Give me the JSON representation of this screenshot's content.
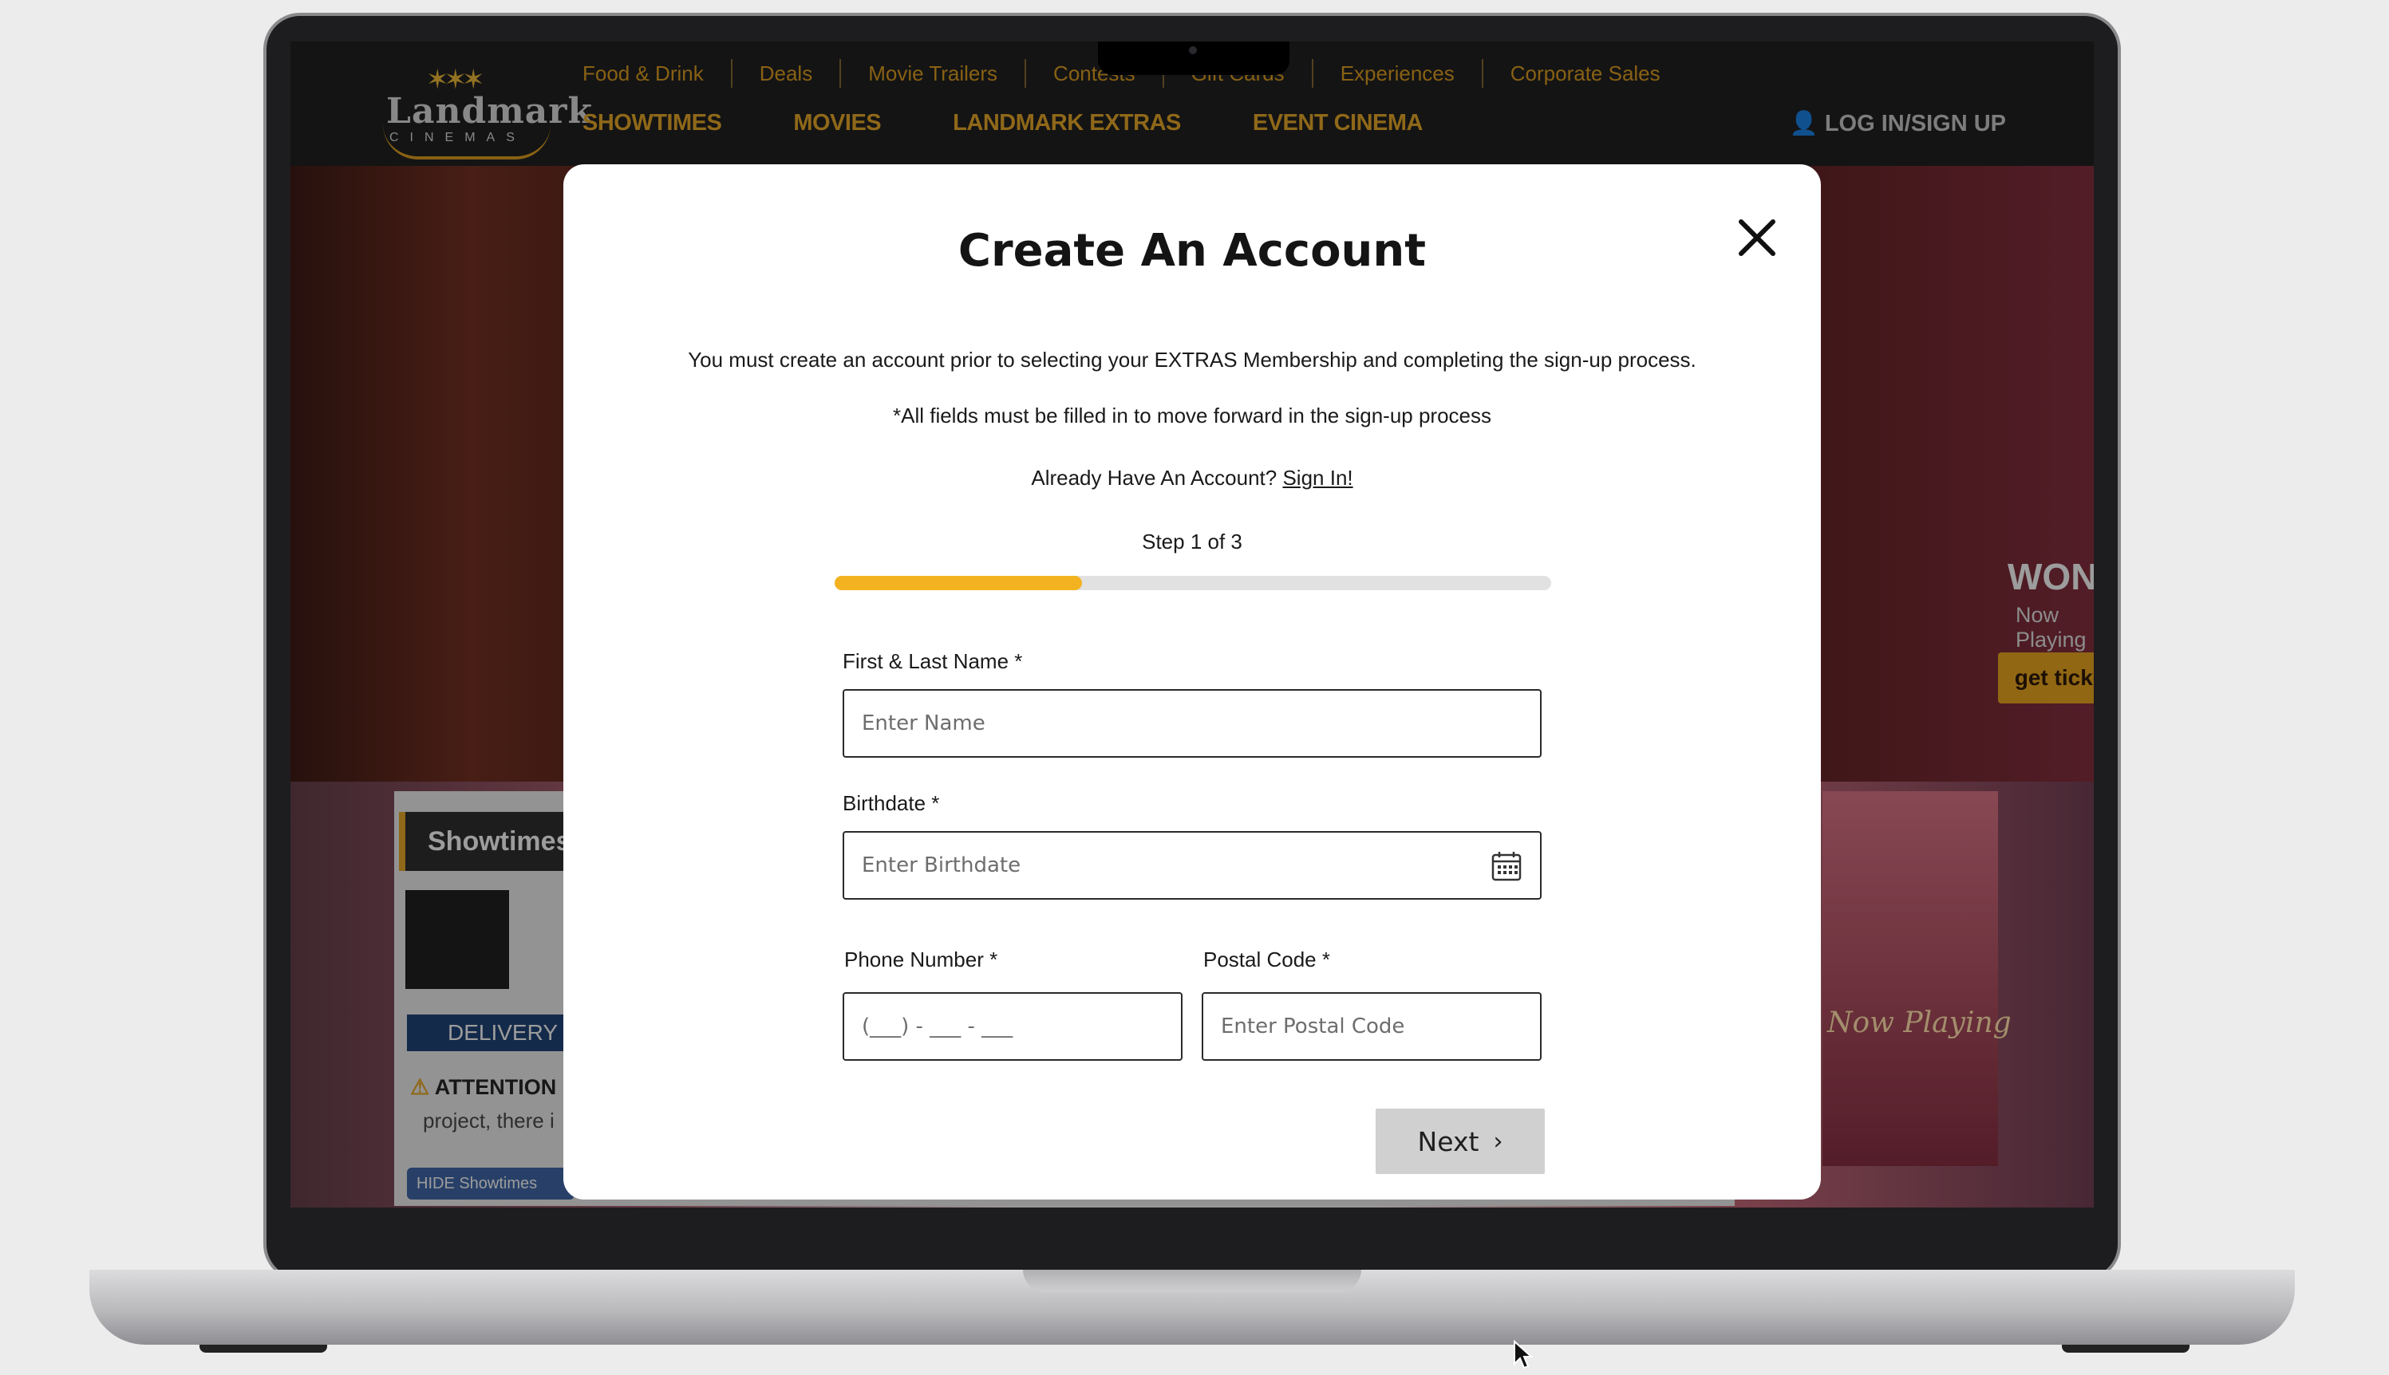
{
  "site": {
    "logo": {
      "word": "Landmark",
      "sub": "CINEMAS"
    },
    "top_links": [
      "Food & Drink",
      "Deals",
      "Movie Trailers",
      "Contests",
      "Gift Cards",
      "Experiences",
      "Corporate Sales"
    ],
    "main_nav": [
      "SHOWTIMES",
      "MOVIES",
      "LANDMARK EXTRAS",
      "EVENT CINEMA"
    ],
    "login": "LOG IN/SIGN UP",
    "hero": {
      "title": "WONKA",
      "subtitle": "Now Playing",
      "button": "get tickets"
    },
    "showtimes": {
      "heading": "Showtimes",
      "delivery": "DELIVERY",
      "attention": "ATTENTION",
      "project_text": "project, there i",
      "hide_button": "HIDE Showtimes"
    },
    "poster_text": "Now Playing"
  },
  "modal": {
    "title": "Create An Account",
    "description": "You must create an account prior to selecting your EXTRAS Membership and completing the sign-up process.",
    "note": "*All fields must be filled in to move forward in the sign-up process",
    "have_account_text": "Already Have An Account?",
    "sign_in_link": "Sign In!",
    "step_text": "Step 1 of 3",
    "progress_fraction": 0.345,
    "fields": {
      "name": {
        "label": "First & Last Name *",
        "placeholder": "Enter Name",
        "value": ""
      },
      "birthdate": {
        "label": "Birthdate *",
        "placeholder": "Enter Birthdate",
        "value": ""
      },
      "phone": {
        "label": "Phone Number *",
        "placeholder": "(___) - ___ - ___",
        "value": ""
      },
      "postal": {
        "label": "Postal Code *",
        "placeholder": "Enter Postal Code",
        "value": ""
      }
    },
    "next_button": "Next",
    "accent_color": "#f3b320"
  }
}
